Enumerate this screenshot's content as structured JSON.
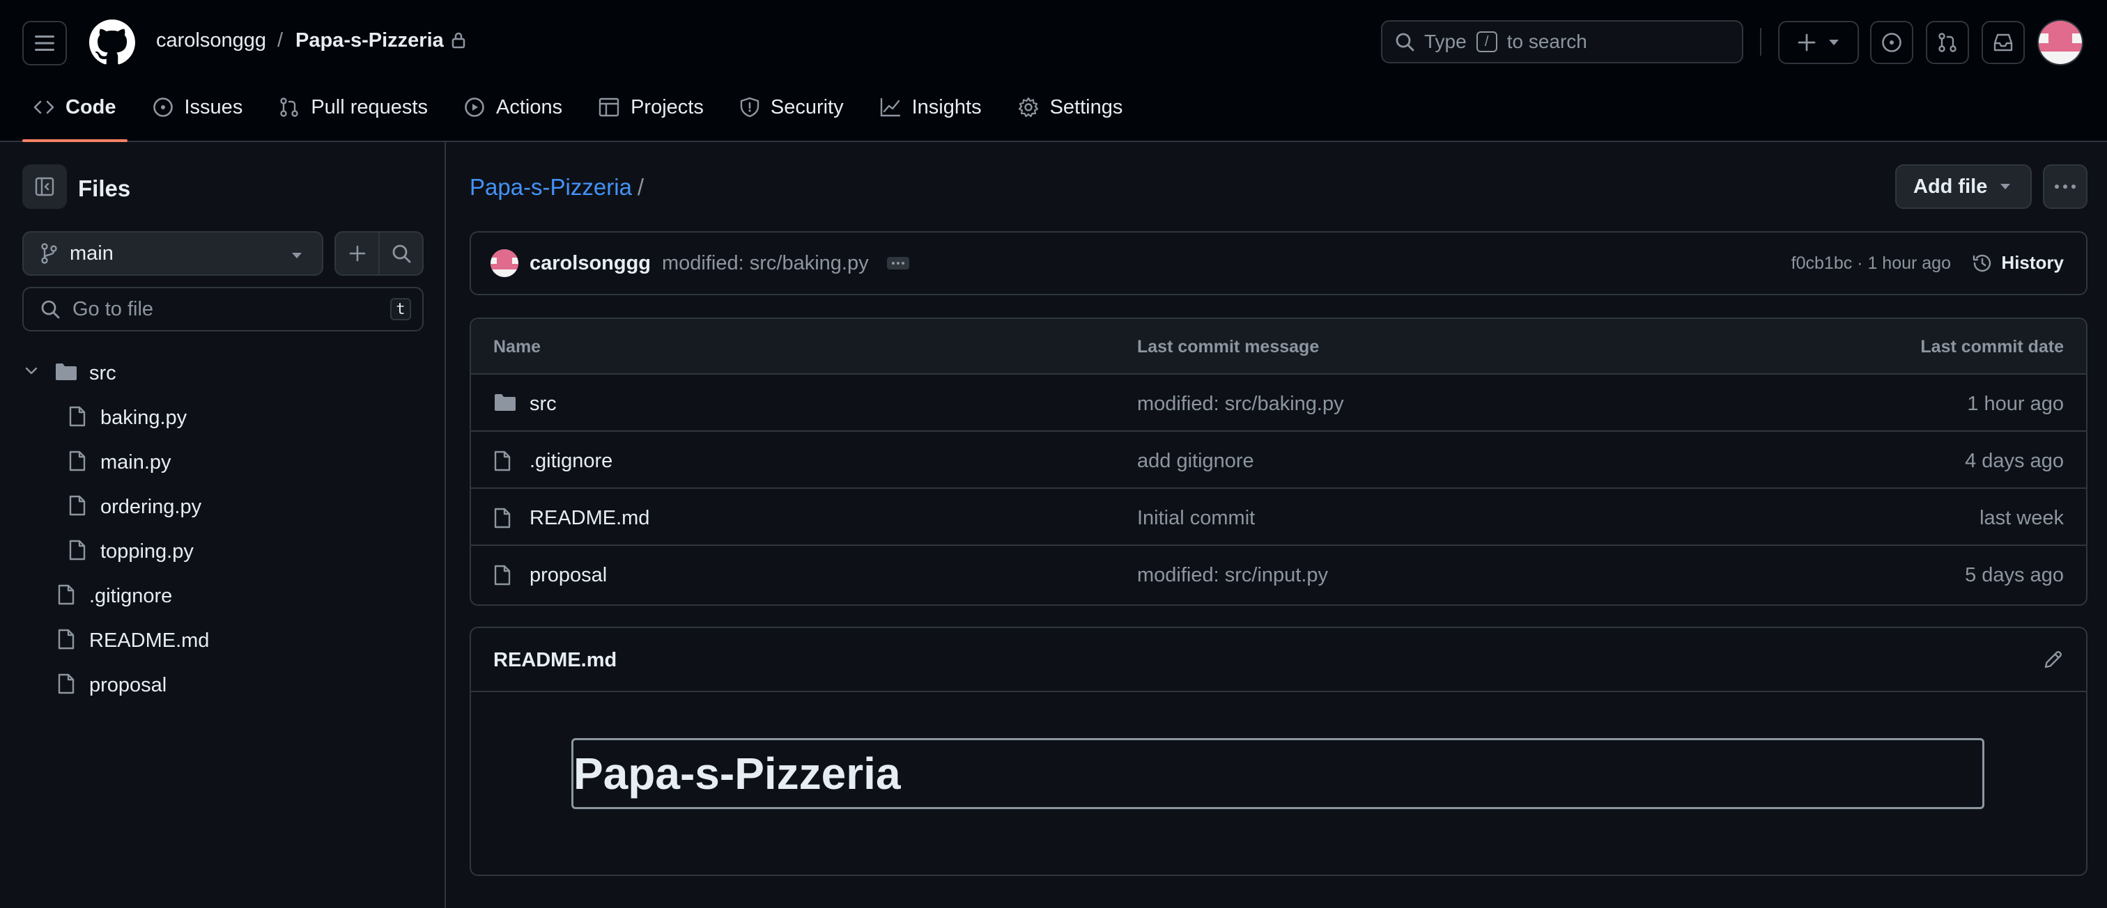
{
  "header": {
    "owner": "carolsonggg",
    "separator": "/",
    "repo": "Papa-s-Pizzeria",
    "search_prefix": "Type",
    "search_key": "/",
    "search_suffix": "to search"
  },
  "repo_nav": {
    "tabs": [
      {
        "label": "Code",
        "icon": "code-icon",
        "active": true
      },
      {
        "label": "Issues",
        "icon": "issue-icon"
      },
      {
        "label": "Pull requests",
        "icon": "pull-request-icon"
      },
      {
        "label": "Actions",
        "icon": "play-icon"
      },
      {
        "label": "Projects",
        "icon": "table-icon"
      },
      {
        "label": "Security",
        "icon": "shield-icon"
      },
      {
        "label": "Insights",
        "icon": "graph-icon"
      },
      {
        "label": "Settings",
        "icon": "gear-icon"
      }
    ]
  },
  "sidebar": {
    "title": "Files",
    "branch": "main",
    "goto_placeholder": "Go to file",
    "goto_key": "t",
    "tree": [
      {
        "label": "src",
        "type": "folder",
        "depth": 0,
        "expanded": true
      },
      {
        "label": "baking.py",
        "type": "file",
        "depth": 1
      },
      {
        "label": "main.py",
        "type": "file",
        "depth": 1
      },
      {
        "label": "ordering.py",
        "type": "file",
        "depth": 1
      },
      {
        "label": "topping.py",
        "type": "file",
        "depth": 1
      },
      {
        "label": ".gitignore",
        "type": "file",
        "depth": 0
      },
      {
        "label": "README.md",
        "type": "file",
        "depth": 0
      },
      {
        "label": "proposal",
        "type": "file",
        "depth": 0
      }
    ]
  },
  "main": {
    "breadcrumb_repo": "Papa-s-Pizzeria",
    "breadcrumb_sep": "/",
    "add_file_label": "Add file",
    "commit": {
      "user": "carolsonggg",
      "message": "modified: src/baking.py",
      "meta": "f0cb1bc · 1 hour ago",
      "history_label": "History"
    },
    "table": {
      "headers": {
        "name": "Name",
        "message": "Last commit message",
        "date": "Last commit date"
      },
      "rows": [
        {
          "name": "src",
          "type": "folder",
          "message": "modified: src/baking.py",
          "date": "1 hour ago"
        },
        {
          "name": ".gitignore",
          "type": "file",
          "message": "add gitignore",
          "date": "4 days ago"
        },
        {
          "name": "README.md",
          "type": "file",
          "message": "Initial commit",
          "date": "last week"
        },
        {
          "name": "proposal",
          "type": "file",
          "message": "modified: src/input.py",
          "date": "5 days ago"
        }
      ]
    },
    "readme": {
      "title": "README.md",
      "heading": "Papa-s-Pizzeria"
    }
  },
  "colors": {
    "background": "#0d1117",
    "header_background": "#010409",
    "border": "#30363d",
    "link": "#4493f8",
    "active_tab_underline": "#f78166",
    "muted_text": "#8d96a0"
  }
}
